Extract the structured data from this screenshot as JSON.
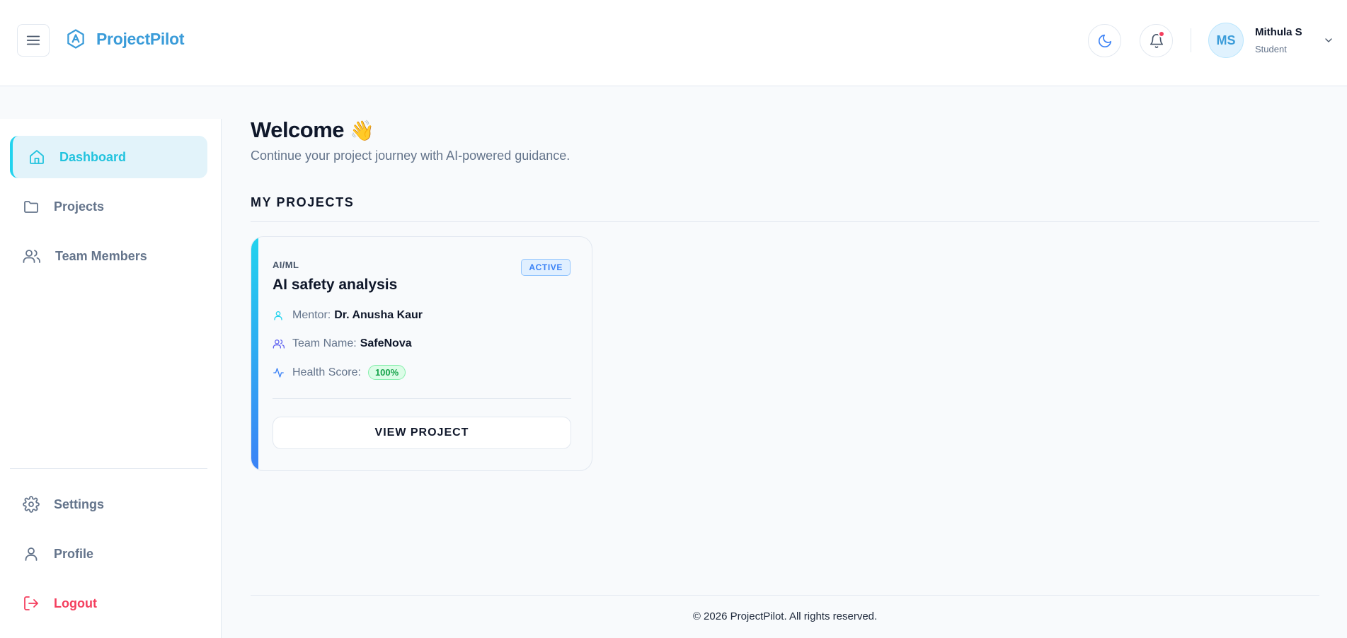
{
  "header": {
    "brand": "ProjectPilot",
    "user": {
      "initials": "MS",
      "name": "Mithula S",
      "role": "Student"
    }
  },
  "sidebar": {
    "items": [
      {
        "label": "Dashboard",
        "icon": "home-icon",
        "active": true
      },
      {
        "label": "Projects",
        "icon": "folder-icon"
      },
      {
        "label": "Team Members",
        "icon": "users-icon"
      }
    ],
    "bottom_items": [
      {
        "label": "Settings",
        "icon": "gear-icon"
      },
      {
        "label": "Profile",
        "icon": "user-icon"
      },
      {
        "label": "Logout",
        "icon": "logout-icon"
      }
    ]
  },
  "main": {
    "welcome": "Welcome",
    "welcome_emoji": "👋",
    "subtitle": "Continue your project journey with AI-powered guidance.",
    "section_title": "MY PROJECTS",
    "project": {
      "category": "AI/ML",
      "status": "ACTIVE",
      "title": "AI safety analysis",
      "mentor_label": "Mentor:",
      "mentor": "Dr. Anusha Kaur",
      "team_label": "Team Name:",
      "team": "SafeNova",
      "health_label": "Health Score:",
      "health": "100%",
      "button": "VIEW PROJECT"
    }
  },
  "footer": {
    "text": "© 2026 ProjectPilot. All rights reserved."
  },
  "colors": {
    "accent": "#22d3ee",
    "brand": "#3b9cd9",
    "danger": "#f43f5e",
    "success": "#16a34a",
    "status_active": "#3b82f6"
  }
}
